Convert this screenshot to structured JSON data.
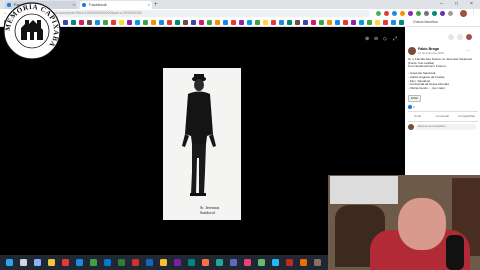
{
  "browser": {
    "tabs": [
      {
        "label": "Facebook"
      },
      {
        "label": "Facebook"
      }
    ],
    "new_tab": "+",
    "window_controls": {
      "minimize": "–",
      "maximize": "□",
      "close": "×"
    },
    "url": "facebook.com/photo/?fbid=10000000000000&set=a.0000000000",
    "bookmarks": {
      "other": "Outros favoritos"
    }
  },
  "logo": {
    "text": "MEMÓRIA CAPIXABA"
  },
  "viewer": {
    "caption_line1": "Sr. Jeremias",
    "caption_line2": "Sandoval",
    "icons": [
      "zoom-in-icon",
      "zoom-out-icon",
      "tag-icon",
      "fullscreen-icon"
    ]
  },
  "post": {
    "author": "Fábio Braga",
    "date": "12 de junho de 2019 · ",
    "lines": [
      "Sr. e Família Seu Franco ou Jeremias Sandoval",
      "(Fonte: foto cedida)",
      "Com Sandoval Fam. Franco:",
      "",
      "- Jeremias Sandoval",
      "- Carlos Augusto de Freitas",
      "- Fam. Sandoval",
      "- Conhecida da Graça Almeida",
      "- Vitória Centro ... (ler mais)"
    ],
    "edit_label": "Editar",
    "reaction_count": "2",
    "actions": {
      "like": "Curtir",
      "comment": "Comentar",
      "share": "Compartilhar"
    },
    "comment_placeholder": "Escreva um comentário..."
  }
}
